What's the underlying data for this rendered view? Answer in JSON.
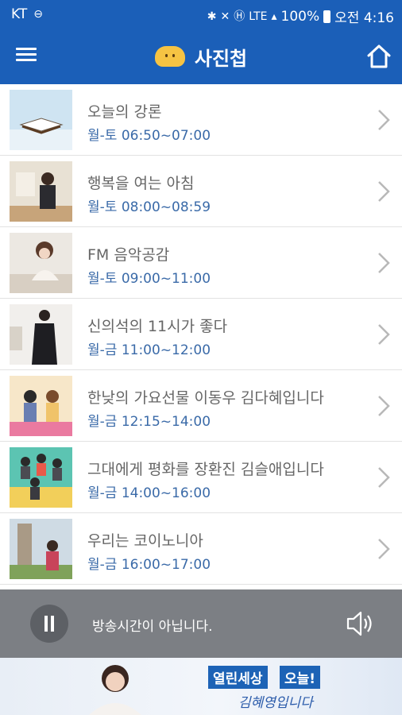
{
  "status_bar": {
    "carrier": "KT",
    "network": "LTE",
    "battery": "100%",
    "time": "오전 4:16"
  },
  "app_bar": {
    "title": "사진첩"
  },
  "programs": [
    {
      "title": "오늘의 강론",
      "time": "월-토 06:50~07:00"
    },
    {
      "title": "행복을 여는 아침",
      "time": "월-토 08:00~08:59"
    },
    {
      "title": "FM 음악공감",
      "time": "월-토 09:00~11:00"
    },
    {
      "title": "신의석의 11시가 좋다",
      "time": "월-금 11:00~12:00"
    },
    {
      "title": "한낮의 가요선물  이동우 김다혜입니다",
      "time": "월-금 12:15~14:00"
    },
    {
      "title": "그대에게 평화를  장환진 김슬애입니다",
      "time": "월-금 14:00~16:00"
    },
    {
      "title": "우리는 코이노니아",
      "time": "월-금 16:00~17:00"
    }
  ],
  "player": {
    "status": "방송시간이 아닙니다."
  },
  "banner": {
    "tag1": "열린세상",
    "tag2": "오늘!",
    "subtitle": "김혜영입니다"
  },
  "colors": {
    "primary": "#1b5fb8",
    "player_bg": "#7c7f84",
    "time_text": "#3a6aa8"
  }
}
